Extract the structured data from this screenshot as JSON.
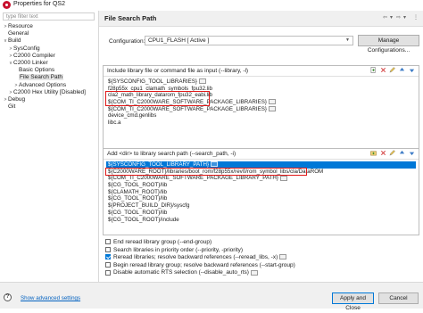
{
  "window": {
    "title": "Properties for QS2"
  },
  "sidebar": {
    "filter_placeholder": "type filter text",
    "items": [
      {
        "label": "Resource",
        "twisty": ">"
      },
      {
        "label": "General",
        "twisty": ""
      },
      {
        "label": "Build",
        "twisty": "v"
      },
      {
        "label": "SysConfig",
        "twisty": ">"
      },
      {
        "label": "C2000 Compiler",
        "twisty": ">"
      },
      {
        "label": "C2000 Linker",
        "twisty": "v"
      },
      {
        "label": "Basic Options",
        "twisty": ""
      },
      {
        "label": "File Search Path",
        "twisty": "",
        "selected": true
      },
      {
        "label": "Advanced Options",
        "twisty": ">"
      },
      {
        "label": "C2000 Hex Utility  [Disabled]",
        "twisty": ">"
      },
      {
        "label": "Debug",
        "twisty": ">"
      },
      {
        "label": "Git",
        "twisty": ""
      }
    ]
  },
  "page": {
    "title": "File Search Path",
    "nav": {
      "back": "⇦",
      "back_menu": "▾",
      "forward": "⇨",
      "forward_menu": "▾",
      "more": "⋮"
    }
  },
  "configuration": {
    "label": "Configuration:",
    "value": "CPU1_FLASH  [ Active ]",
    "manage_button": "Manage Configurations..."
  },
  "library_panel": {
    "header": "Include library file or command file as input (--library, -l)",
    "items": [
      "${SYSCONFIG_TOOL_LIBRARIES}",
      "f28p55x_cpu1_clamath_symbols_fpu32.lib",
      "cla2_math_library_datarom_fpu32_eabi.lib",
      "${COM_TI_C2000WARE_SOFTWARE_PACKAGE_LIBRARIES}",
      "${COM_TI_C2000WARE_SOFTWARE_PACKAGE_LIBRARIES}",
      "device_cmd.genlibs",
      "libc.a"
    ]
  },
  "search_panel": {
    "header": "Add <dir> to library search path (--search_path, -i)",
    "items": [
      "${SYSCONFIG_TOOL_LIBRARY_PATH}",
      "${C2000WARE_ROOT}/libraries/boot_rom/f28p55x/rev0/rom_symbol_libs/cla/DataROM",
      "${COM_TI_C2000WARE_SOFTWARE_PACKAGE_LIBRARY_PATH}",
      "${CG_TOOL_ROOT}/lib",
      "${CLAMATH_ROOT}/lib",
      "${CG_TOOL_ROOT}/lib",
      "${PROJECT_BUILD_DIR}/syscfg",
      "${CG_TOOL_ROOT}/lib",
      "${CG_TOOL_ROOT}/include"
    ],
    "selected_index": 0
  },
  "options": [
    {
      "label": "End reread library group (--end-group)",
      "checked": false,
      "has_icon": false
    },
    {
      "label": "Search libraries in priority order (--priority, -priority)",
      "checked": false,
      "has_icon": false
    },
    {
      "label": "Reread libraries; resolve backward references (--reread_libs, -x)",
      "checked": true,
      "has_icon": true
    },
    {
      "label": "Begin reread library group; resolve backward references (--start-group)",
      "checked": false,
      "has_icon": false
    },
    {
      "label": "Disable automatic RTS selection (--disable_auto_rts)",
      "checked": false,
      "has_icon": true
    }
  ],
  "footer": {
    "help": "?",
    "show_advanced": "Show advanced settings",
    "apply_close": "Apply and Close",
    "cancel": "Cancel"
  }
}
